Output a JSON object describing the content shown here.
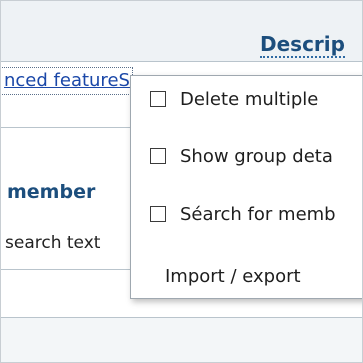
{
  "header": {
    "column_title": "Descrip"
  },
  "toolbar": {
    "advanced_link": "nced featureS"
  },
  "form": {
    "member_label": "member",
    "search_placeholder": "search text"
  },
  "menu": {
    "items": [
      {
        "label": "Delete multiple",
        "has_checkbox": true,
        "checked": false
      },
      {
        "label": "Show group deta",
        "has_checkbox": true,
        "checked": false
      },
      {
        "label": "Séarch for memb",
        "has_checkbox": true,
        "checked": false
      },
      {
        "label": "Import / export",
        "has_checkbox": false
      }
    ]
  },
  "colors": {
    "header_text": "#1c4e7d",
    "link_text": "#1a47a8",
    "menu_border": "#9fa8b0"
  }
}
